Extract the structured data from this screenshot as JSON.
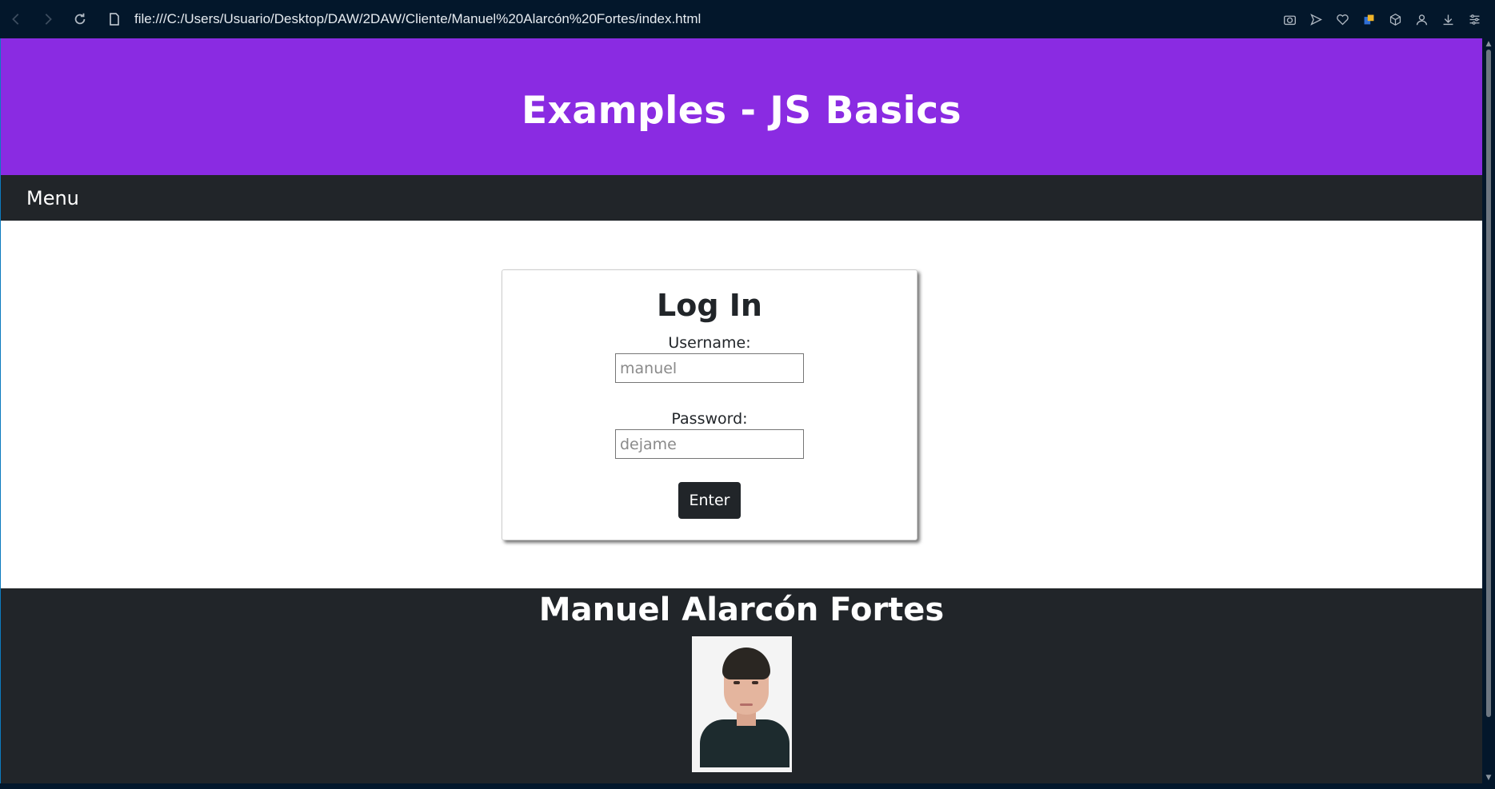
{
  "browser": {
    "url": "file:///C:/Users/Usuario/Desktop/DAW/2DAW/Cliente/Manuel%20Alarcón%20Fortes/index.html"
  },
  "header": {
    "title": "Examples - JS Basics"
  },
  "menu": {
    "label": "Menu"
  },
  "login": {
    "title": "Log In",
    "username_label": "Username:",
    "username_placeholder": "manuel",
    "password_label": "Password:",
    "password_placeholder": "dejame",
    "submit_label": "Enter"
  },
  "footer": {
    "author": "Manuel Alarcón Fortes"
  },
  "colors": {
    "header_bg": "#8a2be2",
    "nav_bg": "#212529",
    "browser_bg": "#03172b"
  },
  "icons": [
    "back-icon",
    "forward-icon",
    "reload-icon",
    "page-icon",
    "camera-icon",
    "send-icon",
    "heart-icon",
    "extension-icon",
    "box-icon",
    "profile-icon",
    "download-icon",
    "settings-icon"
  ]
}
